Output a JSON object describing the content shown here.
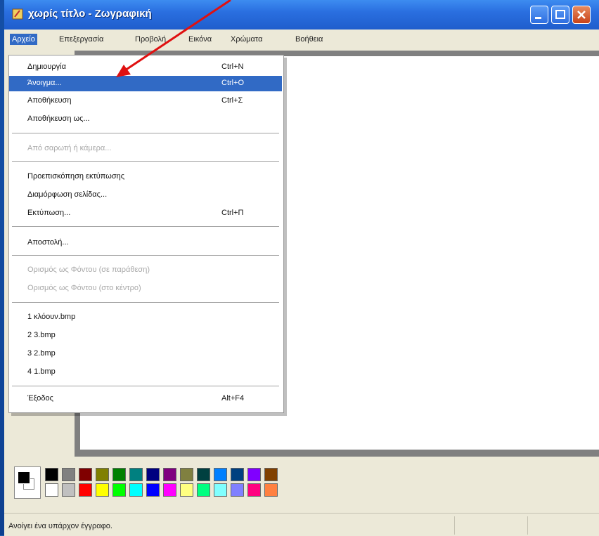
{
  "window": {
    "title": "χωρίς τίτλο - Ζωγραφική"
  },
  "menubar": {
    "items": [
      {
        "label": "Αρχείο"
      },
      {
        "label": "Επεξεργασία"
      },
      {
        "label": "Προβολή"
      },
      {
        "label": "Εικόνα"
      },
      {
        "label": "Χρώματα"
      },
      {
        "label": "Βοήθεια"
      }
    ]
  },
  "file_menu": {
    "new": {
      "label": "Δημιουργία",
      "shortcut": "Ctrl+N"
    },
    "open": {
      "label": "Άνοιγμα...",
      "shortcut": "Ctrl+O"
    },
    "save": {
      "label": "Αποθήκευση",
      "shortcut": "Ctrl+Σ"
    },
    "save_as": {
      "label": "Αποθήκευση ως..."
    },
    "from_scanner": {
      "label": "Από σαρωτή ή κάμερα..."
    },
    "print_preview": {
      "label": "Προεπισκόπηση εκτύπωσης"
    },
    "page_setup": {
      "label": "Διαμόρφωση σελίδας..."
    },
    "print": {
      "label": "Εκτύπωση...",
      "shortcut": "Ctrl+Π"
    },
    "send": {
      "label": "Αποστολή..."
    },
    "bg_tile": {
      "label": "Ορισμός ως Φόντου (σε παράθεση)"
    },
    "bg_center": {
      "label": "Ορισμός ως Φόντου (στο κέντρο)"
    },
    "recent": [
      {
        "label": "1 κλόουν.bmp"
      },
      {
        "label": "2 3.bmp"
      },
      {
        "label": "3 2.bmp"
      },
      {
        "label": "4 1.bmp"
      }
    ],
    "exit": {
      "label": "Έξοδος",
      "shortcut": "Alt+F4"
    }
  },
  "palette": {
    "top_row": [
      "#000000",
      "#808080",
      "#800000",
      "#808000",
      "#008000",
      "#008080",
      "#000080",
      "#800080",
      "#808040",
      "#004040",
      "#0080ff",
      "#004080",
      "#8000ff",
      "#804000"
    ],
    "bottom_row": [
      "#ffffff",
      "#c0c0c0",
      "#ff0000",
      "#ffff00",
      "#00ff00",
      "#00ffff",
      "#0000ff",
      "#ff00ff",
      "#ffff80",
      "#00ff80",
      "#80ffff",
      "#8080ff",
      "#ff0080",
      "#ff8040"
    ]
  },
  "status": {
    "text": "Ανοίγει ένα υπάρχον έγγραφο."
  }
}
